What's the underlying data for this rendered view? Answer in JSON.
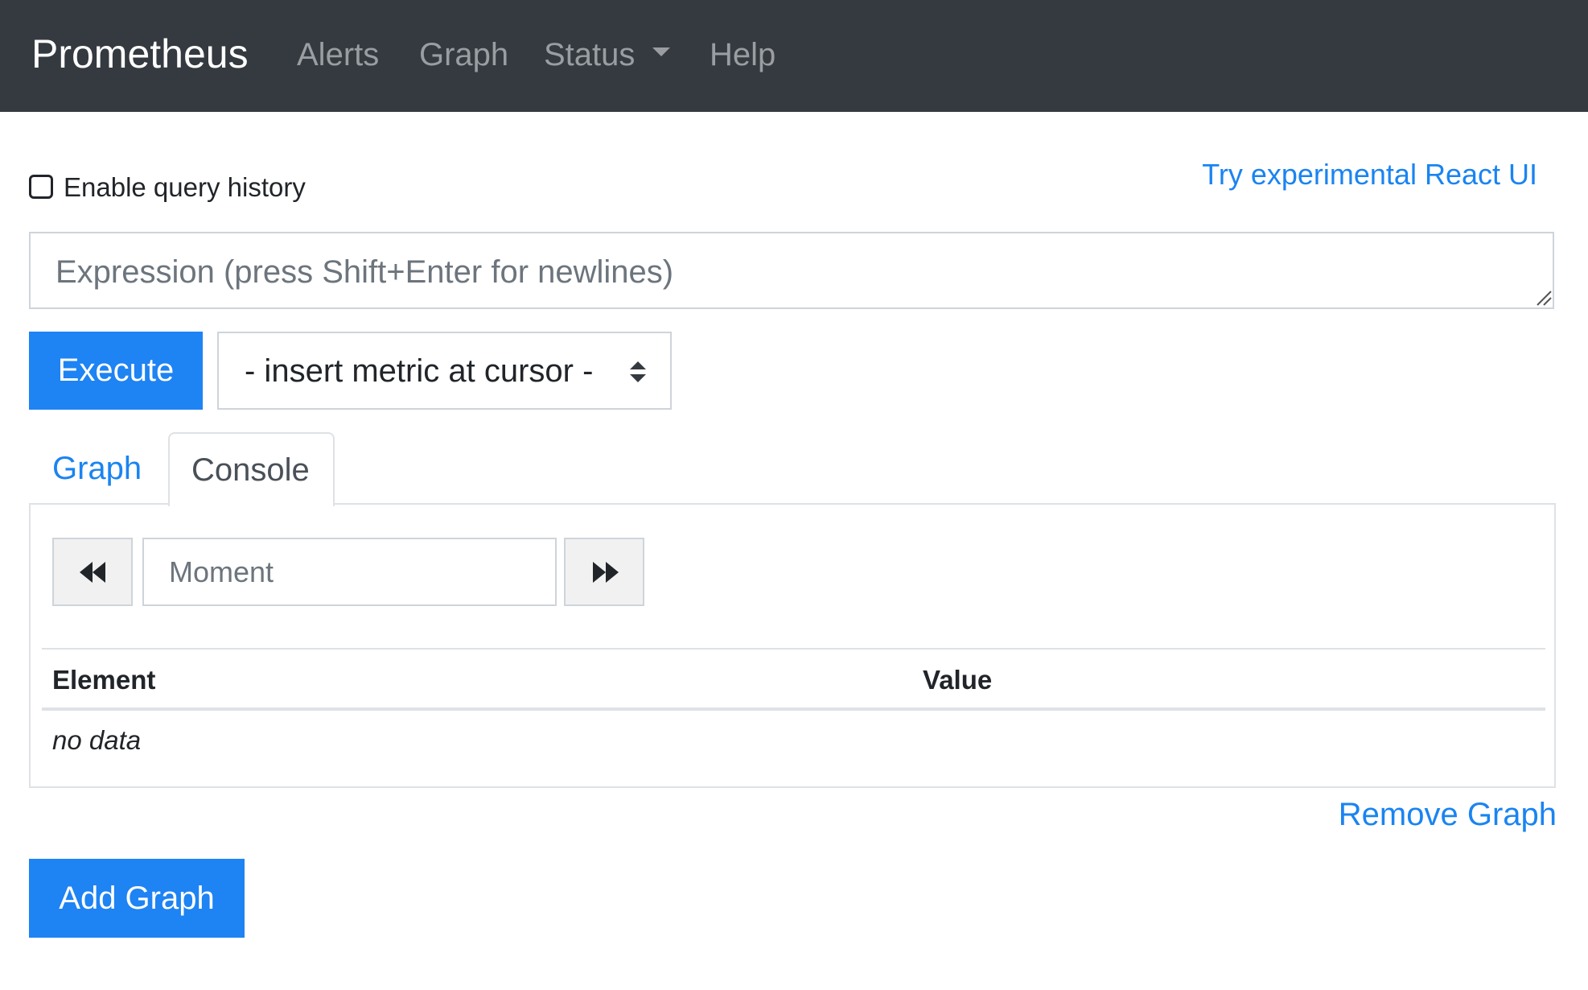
{
  "navbar": {
    "brand": "Prometheus",
    "links": [
      {
        "label": "Alerts"
      },
      {
        "label": "Graph"
      },
      {
        "label": "Status",
        "has_dropdown": true
      },
      {
        "label": "Help"
      }
    ]
  },
  "query_history": {
    "label": "Enable query history",
    "checked": false
  },
  "react_ui_link": "Try experimental React UI",
  "expression": {
    "placeholder": "Expression (press Shift+Enter for newlines)",
    "value": ""
  },
  "execute_label": "Execute",
  "metric_select": {
    "selected": "- insert metric at cursor -"
  },
  "tabs": [
    {
      "label": "Graph",
      "active": false
    },
    {
      "label": "Console",
      "active": true
    }
  ],
  "console": {
    "moment_placeholder": "Moment",
    "columns": [
      "Element",
      "Value"
    ],
    "empty_text": "no data"
  },
  "remove_graph_label": "Remove Graph",
  "add_graph_label": "Add Graph",
  "colors": {
    "navbar_bg": "#343a40",
    "primary": "#1e83f3",
    "link": "#1a84f1"
  },
  "icons": [
    "chevron-down-icon",
    "select-arrows-icon",
    "backward-icon",
    "forward-icon",
    "resize-grip-icon"
  ]
}
